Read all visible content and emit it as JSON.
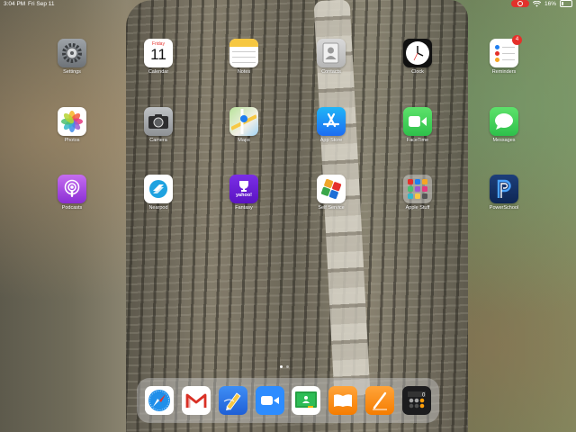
{
  "status_bar": {
    "time": "3:04 PM",
    "date": "Fri Sep 11",
    "battery_percent": "16%",
    "battery_level": 0.16
  },
  "calendar": {
    "weekday": "Friday",
    "day": "11"
  },
  "apps": {
    "settings": "Settings",
    "calendar": "Calendar",
    "notes": "Notes",
    "contacts": "Contacts",
    "clock": "Clock",
    "reminders": "Reminders",
    "photos": "Photos",
    "camera": "Camera",
    "maps": "Maps",
    "app_store": "App Store",
    "facetime": "FaceTime",
    "messages": "Messages",
    "podcasts": "Podcasts",
    "nearpod": "Nearpod",
    "fantasy": "Fantasy",
    "self_service": "Self Service",
    "apple_stuff": "Apple Stuff",
    "powerschool": "PowerSchool"
  },
  "reminders_badge": "4",
  "dock": [
    "safari-icon",
    "gmail-icon",
    "sketch-icon",
    "zoom-icon",
    "classroom-icon",
    "books-icon",
    "pages-icon",
    "calculator-icon"
  ],
  "page_dots": {
    "count": 2,
    "active": 1
  }
}
